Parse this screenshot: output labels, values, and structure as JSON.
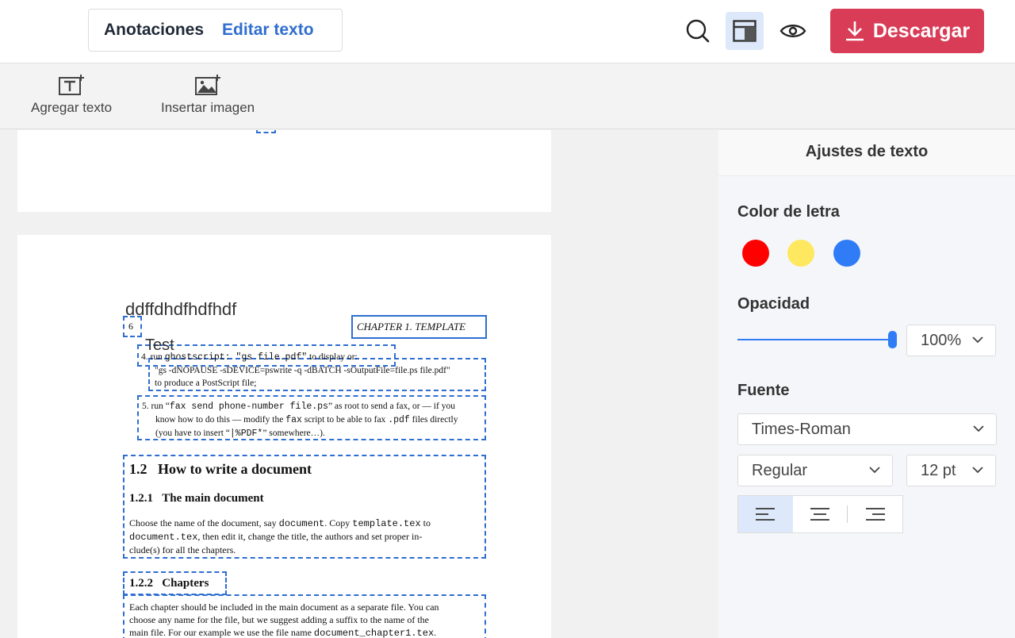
{
  "header": {
    "tabs": [
      {
        "label": "Anotaciones"
      },
      {
        "label": "Editar texto"
      }
    ],
    "download_label": "Descargar"
  },
  "toolbar": {
    "items": [
      {
        "label": "Agregar texto",
        "icon": "add-text-icon"
      },
      {
        "label": "Insertar imagen",
        "icon": "insert-image-icon"
      }
    ]
  },
  "document": {
    "page2": {
      "added_text_1": "ddffdhdfhdfhdf",
      "added_text_2": "Test",
      "page_number": "6",
      "chapter_header": "CHAPTER 1.  TEMPLATE",
      "item4": {
        "num": "4.",
        "p1": "run ",
        "c1": "ghostscript: \"gs file.pdf\"",
        "p2": " to display or:",
        "line2": "\"gs -dNOPAUSE -sDEVICE=pswrite -q -dBATCH -sOutputFile=file.ps file.pdf\"",
        "line3": "to produce a PostScript file;"
      },
      "item5": {
        "num": "5.",
        "p1": "run “",
        "c1": "fax send phone-number file.ps",
        "p2": "” as root to send a fax, or — if you",
        "l2a": "know how to do this — modify the ",
        "l2c": "fax",
        "l2b": " script to be able to fax ",
        "l2c2": ".pdf",
        "l2d": " files directly",
        "l3a": "(you have to insert “",
        "l3c": "|%PDF*",
        "l3b": "” somewhere…)."
      },
      "section": {
        "num": "1.2",
        "title": "How to write a document"
      },
      "subsection1": {
        "num": "1.2.1",
        "title": "The main document"
      },
      "para1": {
        "a": "Choose the name of the document, say ",
        "c1": "document",
        "b": ". Copy ",
        "c2": "template.tex",
        "d": " to",
        "c3": "document.tex",
        "e": ", then edit it, change the title, the authors and set proper in-",
        "f": "clude(s) for all the chapters."
      },
      "subsection2": {
        "num": "1.2.2",
        "title": "Chapters"
      },
      "para2": {
        "l1": "Each chapter should be included in the main document as a separate file. You can",
        "l2": "choose any name for the file, but we suggest adding a suffix to the name of the",
        "l3a": "main file. For our example we use the file name ",
        "l3c": "document_chapter1.tex",
        "l3b": "."
      }
    }
  },
  "panel": {
    "title": "Ajustes de texto",
    "color_label": "Color de letra",
    "colors": [
      "#ff0000",
      "#fde85f",
      "#2f7cf6"
    ],
    "opacity_label": "Opacidad",
    "opacity_value": "100%",
    "opacity_level": 1.0,
    "font_label": "Fuente",
    "font_value": "Times-Roman",
    "style_value": "Regular",
    "size_value": "12 pt",
    "alignment_selected": "left"
  }
}
